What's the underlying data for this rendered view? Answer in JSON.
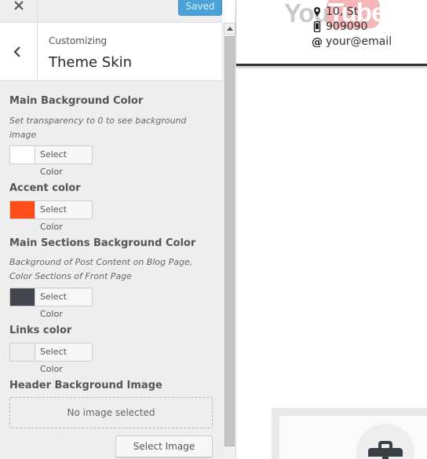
{
  "topbar": {
    "close_icon": "close-icon",
    "save_label": "Saved"
  },
  "section": {
    "eyebrow": "Customizing",
    "title": "Theme Skin"
  },
  "controls": {
    "main_bg": {
      "title": "Main Background Color",
      "description": "Set transparency to 0 to see background image",
      "button_label": "Select Color",
      "color": "#ffffff"
    },
    "accent": {
      "title": "Accent color",
      "button_label": "Select Color",
      "color": "#ff4d1a"
    },
    "sections_bg": {
      "title": "Main Sections Background Color",
      "description": "Background of Post Content on Blog Page, Color Sections of Front Page",
      "button_label": "Select Color",
      "color": "#43474d"
    },
    "links": {
      "title": "Links color",
      "button_label": "Select Color",
      "color": "#eeeeee"
    },
    "header_image": {
      "title": "Header Background Image",
      "placeholder": "No image selected",
      "button_label": "Select Image"
    }
  },
  "preview": {
    "logo_you": "You",
    "logo_tube": "Tube",
    "address": "10, St",
    "phone": "909090",
    "email": "your@email"
  },
  "colors": {
    "primary_button": "#4aa3d8",
    "sidebar_bg": "#eeeeee"
  }
}
